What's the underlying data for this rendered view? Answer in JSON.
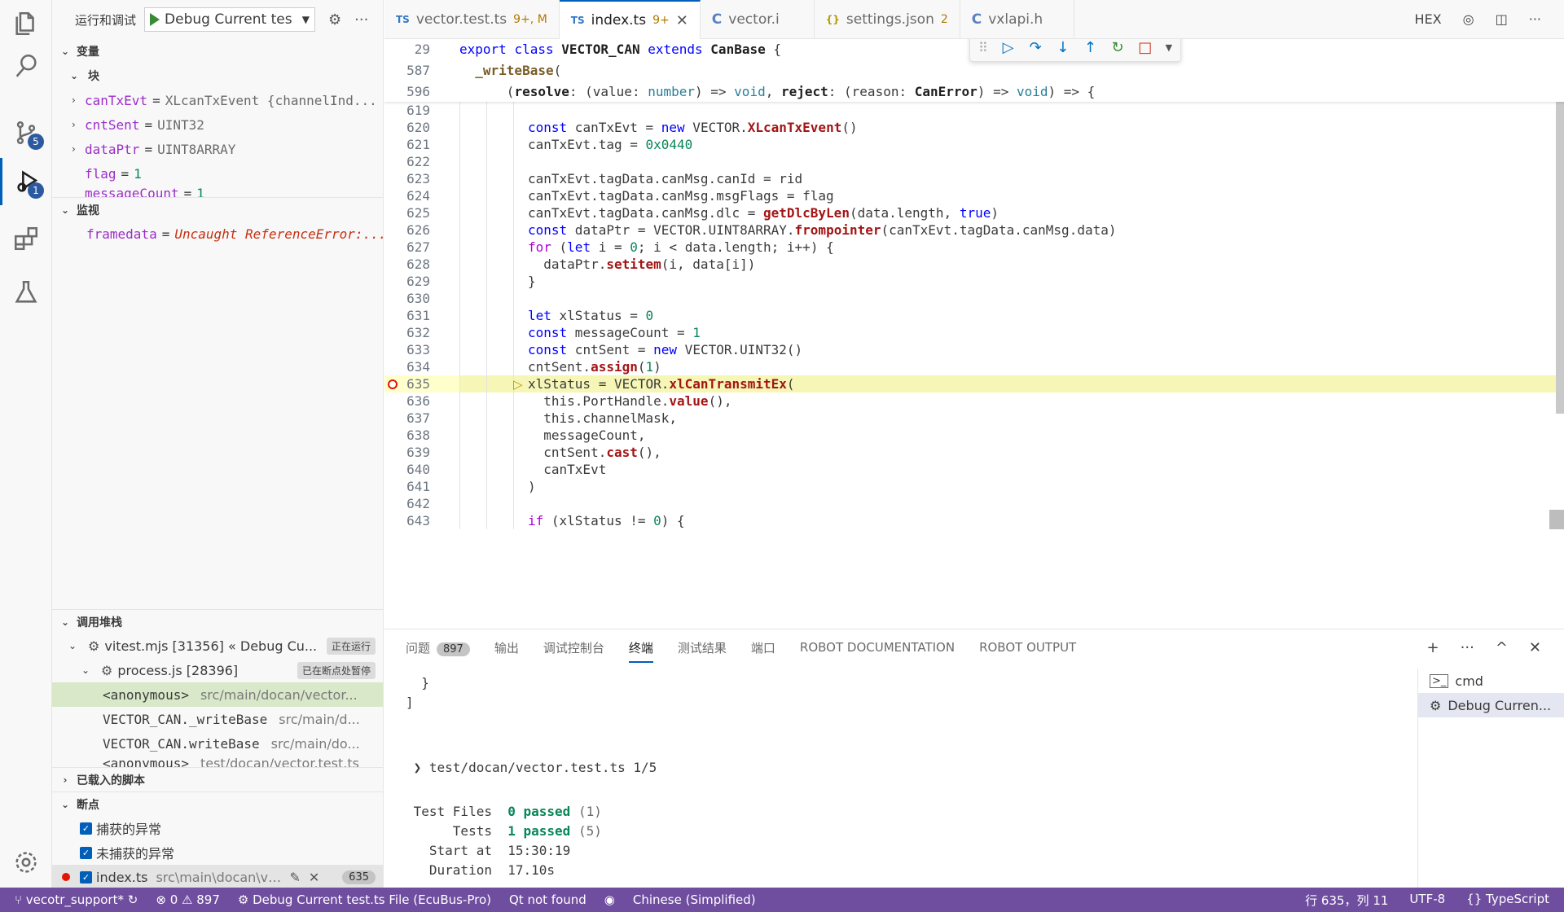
{
  "activity": {
    "items": [
      "explorer-icon",
      "search-icon",
      "source-control-icon",
      "run-debug-icon",
      "extensions-icon",
      "testing-icon"
    ],
    "source_control_badge": "5",
    "debug_badge": "1"
  },
  "sidebar": {
    "title": "运行和调试",
    "launch_config": "Debug Current tes",
    "variables": {
      "header": "变量",
      "scope": "块",
      "items": [
        {
          "name": "canTxEvt",
          "value": "XLcanTxEvent {channelInd..."
        },
        {
          "name": "cntSent",
          "value": "UINT32"
        },
        {
          "name": "dataPtr",
          "value": "UINT8ARRAY"
        },
        {
          "name": "flag",
          "value": "1"
        },
        {
          "name": "messageCount",
          "value": "1"
        }
      ]
    },
    "watch": {
      "header": "监视",
      "items": [
        {
          "name": "framedata",
          "value": "Uncaught ReferenceError:..."
        }
      ]
    },
    "callstack": {
      "header": "调用堆栈",
      "threads": [
        {
          "name": "vitest.mjs [31356] « Debug Cu...",
          "state": "正在运行"
        },
        {
          "name": "process.js [28396]",
          "state": "已在断点处暂停"
        }
      ],
      "frames": [
        {
          "name": "<anonymous>",
          "path": "src/main/docan/vector..."
        },
        {
          "name": "VECTOR_CAN._writeBase",
          "path": "src/main/d..."
        },
        {
          "name": "VECTOR_CAN.writeBase",
          "path": "src/main/do..."
        },
        {
          "name": "<anonymous>",
          "path": "test/docan/vector.test.ts"
        }
      ]
    },
    "loaded_scripts": {
      "header": "已载入的脚本"
    },
    "breakpoints": {
      "header": "断点",
      "items": [
        {
          "label": "捕获的异常"
        },
        {
          "label": "未捕获的异常"
        },
        {
          "label": "index.ts",
          "path": "src\\main\\docan\\ve...",
          "line": "635"
        }
      ]
    }
  },
  "tabs": [
    {
      "lang": "TS",
      "name": "vector.test.ts",
      "mod": "9+, M"
    },
    {
      "lang": "TS",
      "name": "index.ts",
      "mod": "9+",
      "active": true
    },
    {
      "lang": "C",
      "name": "vector.i",
      "mod": ""
    },
    {
      "lang": "{}",
      "name": "settings.json",
      "mod": "2"
    },
    {
      "lang": "C",
      "name": "vxlapi.h",
      "mod": ""
    }
  ],
  "tab_actions": {
    "hex": "HEX"
  },
  "editor": {
    "sticky": [
      {
        "ln": "29",
        "code": "export class VECTOR_CAN extends CanBase {"
      },
      {
        "ln": "587",
        "code": "  _writeBase("
      },
      {
        "ln": "596",
        "code": "    (resolve: (value: number) => void, reject: (reason: CanError) => void) => {"
      }
    ],
    "lines": [
      {
        "ln": "619",
        "code": ""
      },
      {
        "ln": "620",
        "code": "const canTxEvt = new VECTOR.XLcanTxEvent()"
      },
      {
        "ln": "621",
        "code": "canTxEvt.tag = 0x0440"
      },
      {
        "ln": "622",
        "code": ""
      },
      {
        "ln": "623",
        "code": "canTxEvt.tagData.canMsg.canId = rid"
      },
      {
        "ln": "624",
        "code": "canTxEvt.tagData.canMsg.msgFlags = flag"
      },
      {
        "ln": "625",
        "code": "canTxEvt.tagData.canMsg.dlc = getDlcByLen(data.length, true)"
      },
      {
        "ln": "626",
        "code": "const dataPtr = VECTOR.UINT8ARRAY.frompointer(canTxEvt.tagData.canMsg.data)"
      },
      {
        "ln": "627",
        "code": "for (let i = 0; i < data.length; i++) {"
      },
      {
        "ln": "628",
        "code": "  dataPtr.setitem(i, data[i])"
      },
      {
        "ln": "629",
        "code": "}"
      },
      {
        "ln": "630",
        "code": ""
      },
      {
        "ln": "631",
        "code": "let xlStatus = 0"
      },
      {
        "ln": "632",
        "code": "const messageCount = 1"
      },
      {
        "ln": "633",
        "code": "const cntSent = new VECTOR.UINT32()"
      },
      {
        "ln": "634",
        "code": "cntSent.assign(1)"
      },
      {
        "ln": "635",
        "code": "xlStatus = VECTOR.xlCanTransmitEx(",
        "current": true
      },
      {
        "ln": "636",
        "code": "  this.PortHandle.value(),"
      },
      {
        "ln": "637",
        "code": "  this.channelMask,"
      },
      {
        "ln": "638",
        "code": "  messageCount,"
      },
      {
        "ln": "639",
        "code": "  cntSent.cast(),"
      },
      {
        "ln": "640",
        "code": "  canTxEvt"
      },
      {
        "ln": "641",
        "code": ")"
      },
      {
        "ln": "642",
        "code": ""
      },
      {
        "ln": "643",
        "code": "if (xlStatus != 0) {"
      }
    ]
  },
  "panel": {
    "tabs": [
      "问题",
      "输出",
      "调试控制台",
      "终端",
      "测试结果",
      "端口",
      "ROBOT DOCUMENTATION",
      "ROBOT OUTPUT"
    ],
    "problems_count": "897",
    "active_tab": "终端",
    "terminal": {
      "lines": [
        "  }",
        "]",
        "",
        "",
        " ❯ test/docan/vector.test.ts 1/5",
        "",
        " Test Files  0 passed (1)",
        "      Tests  1 passed (5)",
        "   Start at  15:30:19",
        "   Duration  17.10s"
      ]
    },
    "terminals": [
      {
        "name": "cmd",
        "icon": "terminal-icon"
      },
      {
        "name": "Debug Curren...",
        "icon": "debug-icon"
      }
    ]
  },
  "status": {
    "branch": "vecotr_support*",
    "errors": "0",
    "warnings": "897",
    "debug": "Debug Current test.ts File (EcuBus-Pro)",
    "qt": "Qt not found",
    "lang_pack": "Chinese (Simplified)",
    "position": "行 635，列 11",
    "encoding": "UTF-8",
    "language": "TypeScript"
  }
}
